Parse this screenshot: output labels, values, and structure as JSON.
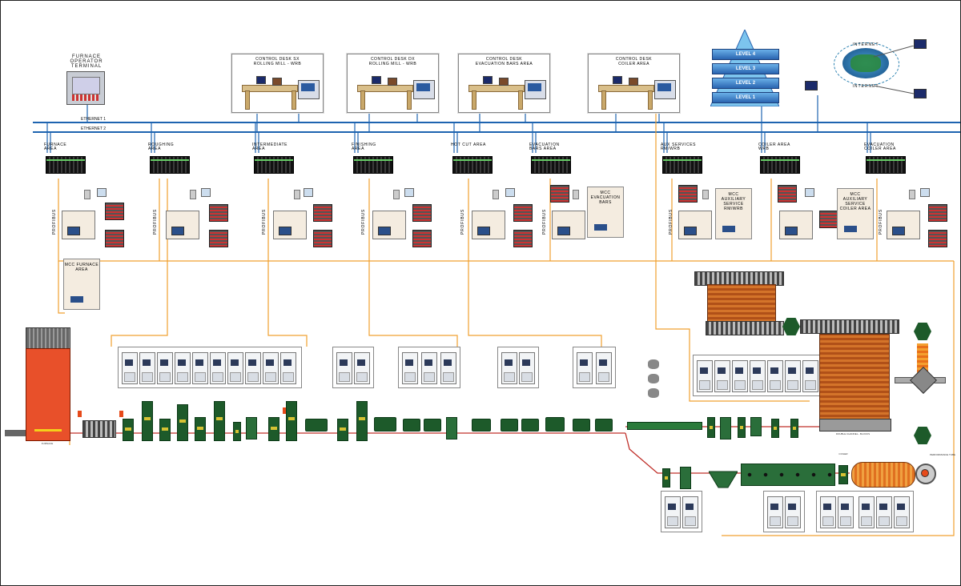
{
  "network": {
    "ethernet1": "ETHERNET 1",
    "ethernet2": "ETHERNET 2",
    "profibus": "PROFIBUS"
  },
  "top": {
    "furnace_terminal": "FURNACE\nOPERATOR\nTERMINAL",
    "desks": [
      "CONTROL DESK SX\nROLLING MILL - WRB",
      "CONTROL DESK DX\nROLLING MILL - WRB",
      "CONTROL DESK\nEVACUATION BARS AREA",
      "CONTROL DESK\nCOILER AREA"
    ],
    "levels": [
      "LEVEL 4",
      "LEVEL 3",
      "LEVEL 2",
      "LEVEL 1"
    ],
    "internet": "INTERNET"
  },
  "areas": [
    "FURNACE\nAREA",
    "ROUGHING\nAREA",
    "INTERMEDIATE\nAREA",
    "FINISHING\nAREA",
    "HOT CUT AREA",
    "EVACUATION\nBARS AREA",
    "AUX SERVICES\nRM/WRB",
    "COILER AREA\nWRB",
    "EVACUATION\nCOILER AREA"
  ],
  "mcc": {
    "furnace": "MCC FURNACE\nAREA",
    "evacuation_bars": "MCC\nEVACUATION\nBARS",
    "aux_rm_wrb": "MCC\nAUXILIARY\nSERVICE\nRM/WRB",
    "aux_coiler": "MCC\nAUXILIARY\nSERVICE\nCOILER AREA"
  },
  "line": {
    "furnace": "FURNACE",
    "cooling_bed": "DOUBLE CHANNEL - BLOCKS",
    "coiler": "COILER",
    "performance_tube": "PERFORMANCE TUBE"
  },
  "colors": {
    "ethernet": "#1e64b0",
    "fieldbus": "#f0a030",
    "signal": "#c0302a",
    "equipment_green": "#1d5a2a",
    "furnace": "#e8502a"
  }
}
